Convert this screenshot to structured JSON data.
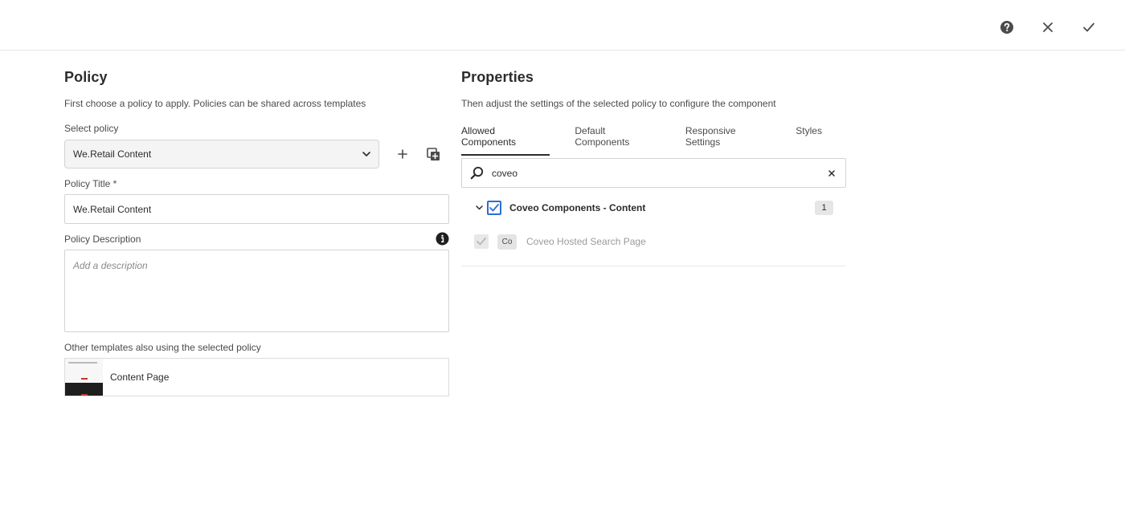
{
  "topbar": {
    "help_icon": "help-circle-icon",
    "close_icon": "close-icon",
    "done_icon": "checkmark-icon"
  },
  "policy": {
    "heading": "Policy",
    "description": "First choose a policy to apply. Policies can be shared across templates",
    "select_label": "Select policy",
    "selected_policy": "We.Retail Content",
    "title_label": "Policy Title *",
    "title_value": "We.Retail Content",
    "description_label": "Policy Description",
    "description_placeholder": "Add a description",
    "templates_label": "Other templates also using the selected policy",
    "templates": [
      {
        "name": "Content Page"
      }
    ]
  },
  "properties": {
    "heading": "Properties",
    "description": "Then adjust the settings of the selected policy to configure the component",
    "tabs": [
      {
        "label": "Allowed Components",
        "active": true
      },
      {
        "label": "Default Components",
        "active": false
      },
      {
        "label": "Responsive Settings",
        "active": false
      },
      {
        "label": "Styles",
        "active": false
      }
    ],
    "search_value": "coveo",
    "group": {
      "label": "Coveo Components - Content",
      "count": "1",
      "checked": true
    },
    "items": [
      {
        "abbr": "Co",
        "label": "Coveo Hosted Search Page",
        "checked": true,
        "disabled": true
      }
    ]
  },
  "colors": {
    "accent": "#2d6fd4",
    "text": "#2c2c2c",
    "muted": "#9a9a9a"
  }
}
